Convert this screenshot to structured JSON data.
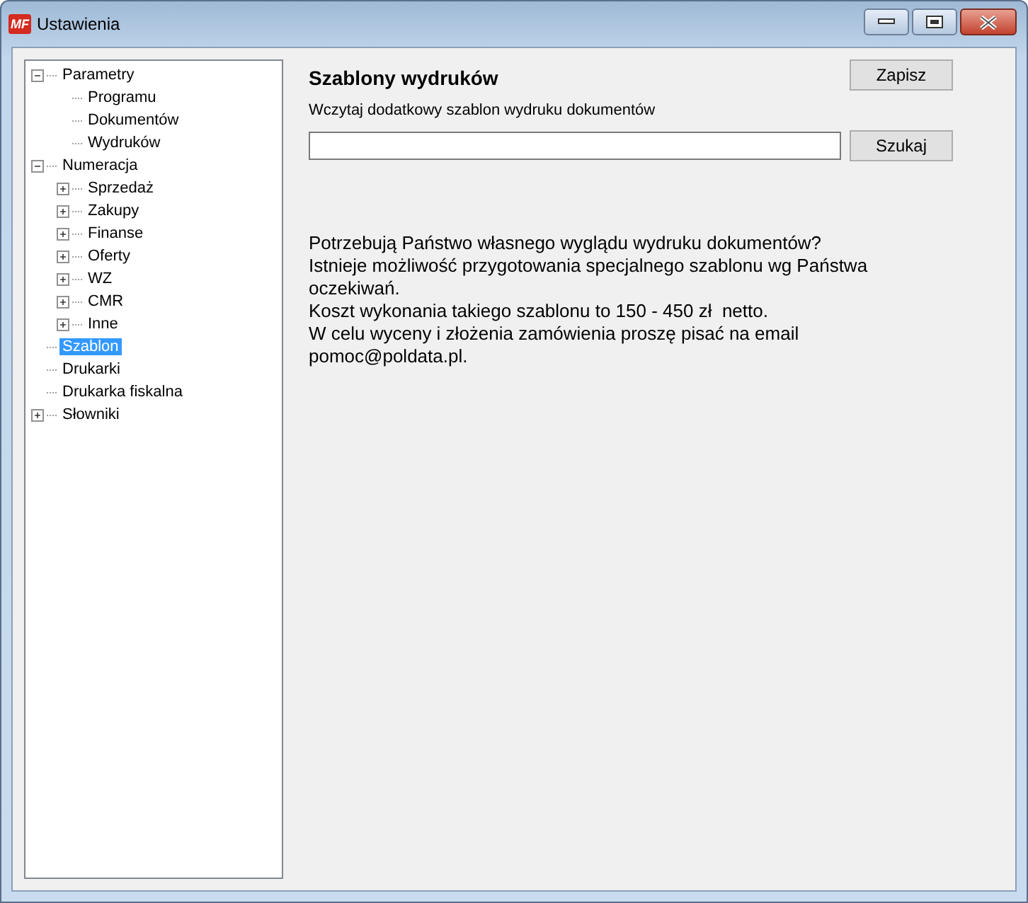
{
  "window": {
    "title": "Ustawienia",
    "app_icon": "MF"
  },
  "tree": [
    {
      "label": "Parametry",
      "kind": "branch",
      "expanded": true,
      "selected": false,
      "children": [
        {
          "label": "Programu",
          "kind": "leaf",
          "selected": false
        },
        {
          "label": "Dokumentów",
          "kind": "leaf",
          "selected": false
        },
        {
          "label": "Wydruków",
          "kind": "leaf",
          "selected": false
        }
      ]
    },
    {
      "label": "Numeracja",
      "kind": "branch",
      "expanded": true,
      "selected": false,
      "children": [
        {
          "label": "Sprzedaż",
          "kind": "branch",
          "expanded": false,
          "selected": false
        },
        {
          "label": "Zakupy",
          "kind": "branch",
          "expanded": false,
          "selected": false
        },
        {
          "label": "Finanse",
          "kind": "branch",
          "expanded": false,
          "selected": false
        },
        {
          "label": "Oferty",
          "kind": "branch",
          "expanded": false,
          "selected": false
        },
        {
          "label": "WZ",
          "kind": "branch",
          "expanded": false,
          "selected": false
        },
        {
          "label": "CMR",
          "kind": "branch",
          "expanded": false,
          "selected": false
        },
        {
          "label": "Inne",
          "kind": "branch",
          "expanded": false,
          "selected": false
        }
      ]
    },
    {
      "label": "Szablon",
      "kind": "leaf",
      "selected": true
    },
    {
      "label": "Drukarki",
      "kind": "leaf",
      "selected": false
    },
    {
      "label": "Drukarka fiskalna",
      "kind": "leaf",
      "selected": false
    },
    {
      "label": "Słowniki",
      "kind": "branch",
      "expanded": false,
      "selected": false
    }
  ],
  "panel": {
    "heading": "Szablony wydruków",
    "save_button": "Zapisz",
    "field_label": "Wczytaj dodatkowy szablon wydruku dokumentów",
    "browse_button": "Szukaj",
    "info_lines": [
      "Potrzebują Państwo własnego wyglądu wydruku dokumentów?",
      "Istnieje możliwość przygotowania specjalnego szablonu wg Państwa",
      "oczekiwań.",
      "Koszt wykonania takiego szablonu to 150 - 450 zł  netto.",
      "W celu wyceny i złożenia zamówienia proszę pisać na email",
      "pomoc@poldata.pl."
    ]
  }
}
